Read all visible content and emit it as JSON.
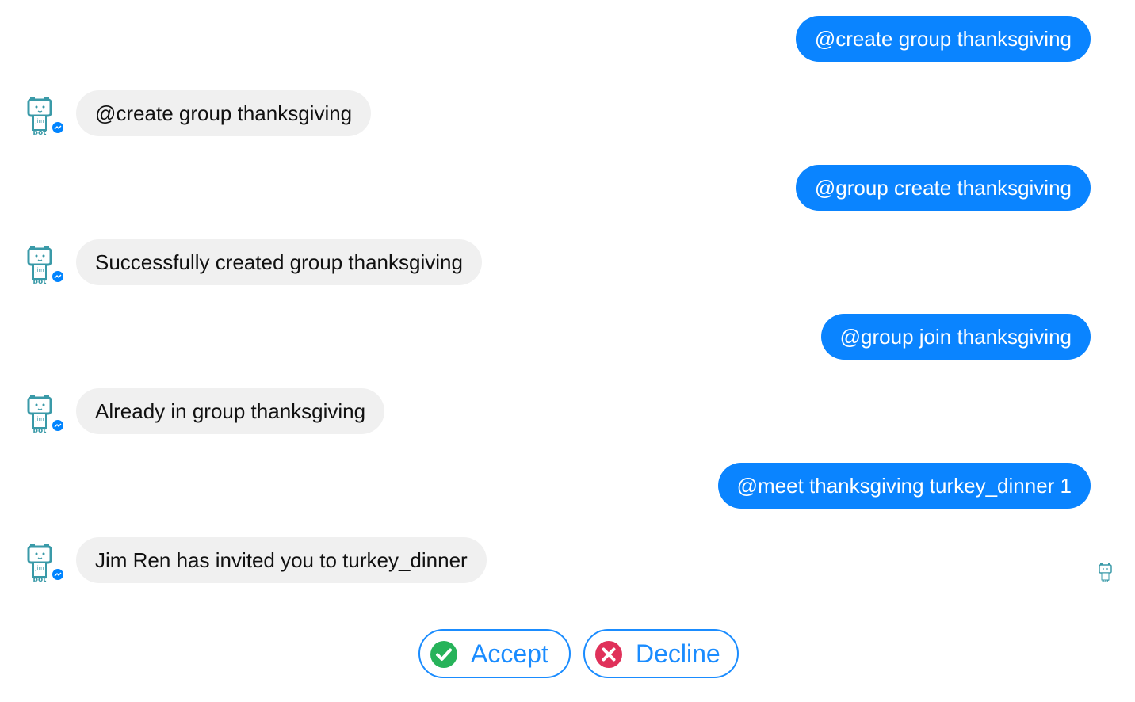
{
  "messages": [
    {
      "side": "out",
      "text": "@create group thanksgiving"
    },
    {
      "side": "in",
      "text": "@create group thanksgiving"
    },
    {
      "side": "out",
      "text": "@group create thanksgiving"
    },
    {
      "side": "in",
      "text": "Successfully created group thanksgiving"
    },
    {
      "side": "out",
      "text": "@group join thanksgiving"
    },
    {
      "side": "in",
      "text": "Already in group thanksgiving"
    },
    {
      "side": "out",
      "text": "@meet thanksgiving turkey_dinner 1"
    },
    {
      "side": "in",
      "text": "Jim Ren has invited you to turkey_dinner"
    }
  ],
  "bot": {
    "avatar_text_top": "Jim",
    "avatar_text_bottom": "bot",
    "avatar_icon": "jimbot-robot-icon",
    "badge_icon": "messenger-icon"
  },
  "actions": {
    "accept_label": "Accept",
    "decline_label": "Decline",
    "accept_icon": "checkmark-circle-icon",
    "decline_icon": "x-circle-icon"
  },
  "colors": {
    "outgoing_bubble": "#0a84ff",
    "incoming_bubble": "#f0f0f0",
    "button_border": "#1a8cff",
    "accept_green": "#27b35a",
    "decline_red": "#e0315a",
    "avatar_teal": "#3a9aa8"
  }
}
